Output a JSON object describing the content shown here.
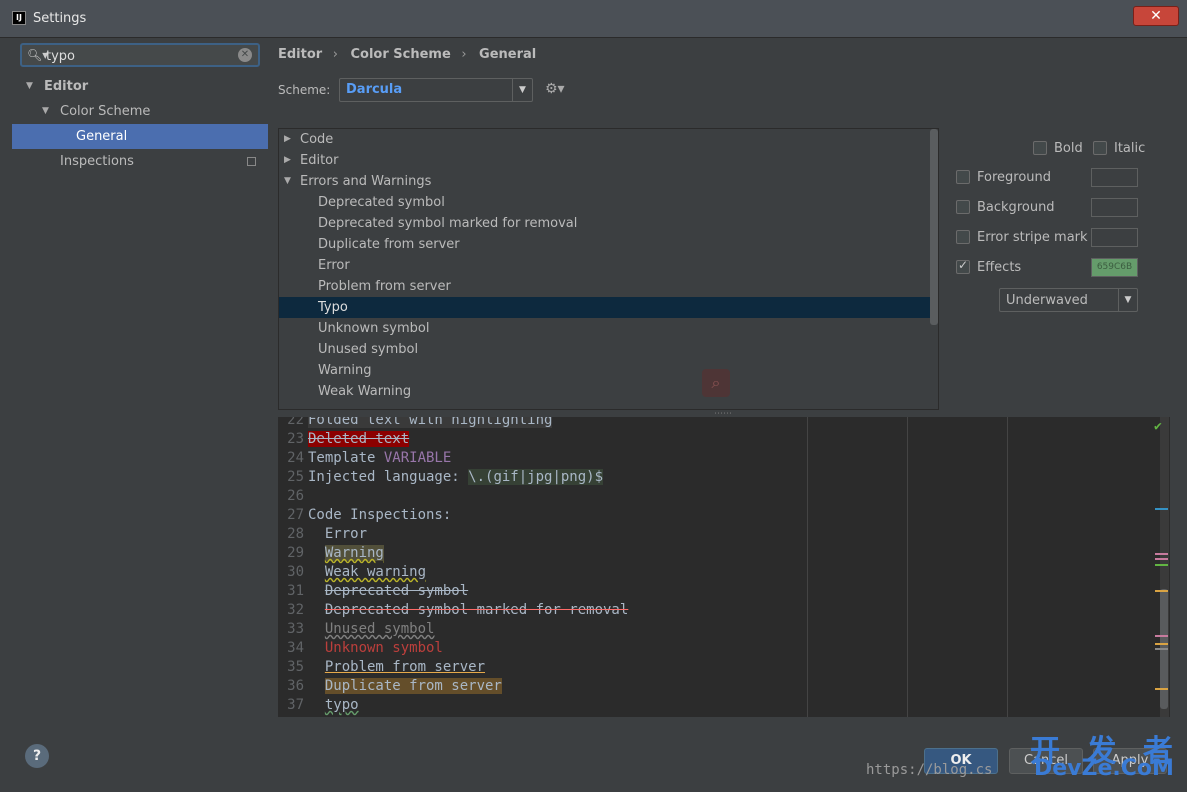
{
  "window": {
    "title": "Settings",
    "close_label": "✕",
    "app_icon": "IJ"
  },
  "search": {
    "value": "typo"
  },
  "sidebar": {
    "items": [
      {
        "label": "Editor"
      },
      {
        "label": "Color Scheme"
      },
      {
        "label": "General"
      },
      {
        "label": "Inspections"
      }
    ]
  },
  "breadcrumb": [
    "Editor",
    "Color Scheme",
    "General"
  ],
  "breadcrumb_sep": "›",
  "scheme": {
    "label": "Scheme:",
    "value": "Darcula"
  },
  "categories": [
    {
      "label": "Code",
      "expanded": false
    },
    {
      "label": "Editor",
      "expanded": false
    },
    {
      "label": "Errors and Warnings",
      "expanded": true
    },
    {
      "label": "Deprecated symbol"
    },
    {
      "label": "Deprecated symbol marked for removal"
    },
    {
      "label": "Duplicate from server"
    },
    {
      "label": "Error"
    },
    {
      "label": "Problem from server"
    },
    {
      "label": "Typo",
      "selected": true
    },
    {
      "label": "Unknown symbol"
    },
    {
      "label": "Unused symbol"
    },
    {
      "label": "Warning"
    },
    {
      "label": "Weak Warning"
    }
  ],
  "options": {
    "bold": "Bold",
    "italic": "Italic",
    "foreground": "Foreground",
    "background": "Background",
    "error_stripe": "Error stripe mark",
    "effects": "Effects",
    "effects_color": "659C6B",
    "effects_type": "Underwaved"
  },
  "colors": {
    "selection": "#4b6eaf",
    "scheme_accent": "#589df6",
    "typo_effect": "#659c6b"
  },
  "preview": [
    {
      "n": "22",
      "t": "Folded text with highlighting"
    },
    {
      "n": "23",
      "t": "Deleted text"
    },
    {
      "n": "24",
      "t": "Template ",
      "t2": "VARIABLE"
    },
    {
      "n": "25",
      "t": "Injected language: ",
      "t2": "\\.(gif|jpg|png)$"
    },
    {
      "n": "26",
      "t": ""
    },
    {
      "n": "27",
      "t": "Code Inspections:"
    },
    {
      "n": "28",
      "t": "Error"
    },
    {
      "n": "29",
      "t": "Warning"
    },
    {
      "n": "30",
      "t": "Weak warning"
    },
    {
      "n": "31",
      "t": "Deprecated symbol"
    },
    {
      "n": "32",
      "t": "Deprecated symbol marked for removal"
    },
    {
      "n": "33",
      "t": "Unused symbol"
    },
    {
      "n": "34",
      "t": "Unknown symbol"
    },
    {
      "n": "35",
      "t": "Problem from server"
    },
    {
      "n": "36",
      "t": "Duplicate from server"
    },
    {
      "n": "37",
      "t": "typo"
    }
  ],
  "buttons": {
    "help": "?",
    "ok": "OK",
    "cancel": "Cancel",
    "apply": "Apply"
  },
  "watermark": {
    "url": "https://blog.cs",
    "logo_top": "开 发 者",
    "logo_bottom": "DevZe.CoM"
  }
}
